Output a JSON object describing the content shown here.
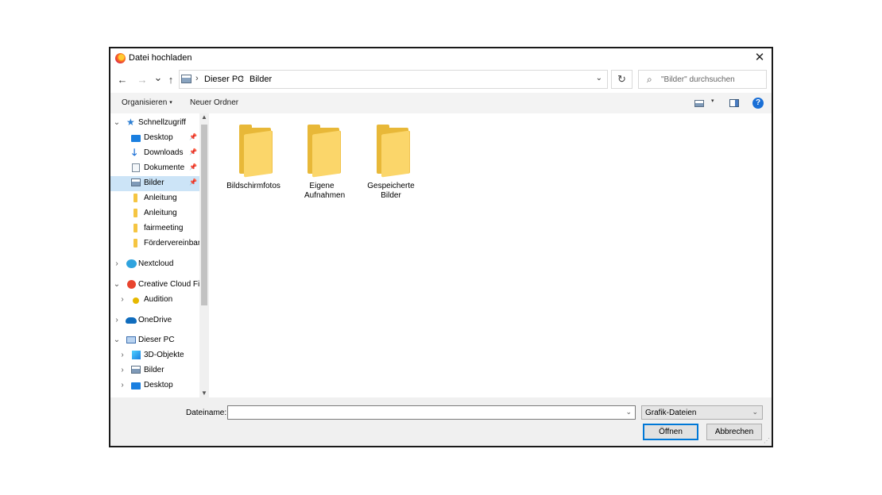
{
  "window": {
    "title": "Datei hochladen",
    "close_glyph": "✕"
  },
  "nav": {
    "back": "←",
    "forward": "→",
    "recent": "⌄",
    "up": "↑"
  },
  "address": {
    "crumbs": [
      "Dieser PC",
      "Bilder"
    ],
    "separator": "›",
    "dropdown": "⌄",
    "refresh": "↻"
  },
  "search": {
    "placeholder": "\"Bilder\" durchsuchen",
    "icon": "⌕"
  },
  "toolbar": {
    "organize": "Organisieren",
    "organize_caret": "▾",
    "new_folder": "Neuer Ordner",
    "view_caret": "▾",
    "help": "?"
  },
  "sidebar": {
    "items": [
      {
        "label": "Schnellzugriff",
        "icon": "star-icon",
        "expanded": true
      },
      {
        "label": "Desktop",
        "icon": "desktop-icon",
        "pinned": true
      },
      {
        "label": "Downloads",
        "icon": "download-icon",
        "pinned": true
      },
      {
        "label": "Dokumente",
        "icon": "document-icon",
        "pinned": true
      },
      {
        "label": "Bilder",
        "icon": "pictures-icon",
        "pinned": true,
        "selected": true
      },
      {
        "label": "Anleitung",
        "icon": "folder-icon"
      },
      {
        "label": "Anleitung",
        "icon": "folder-icon"
      },
      {
        "label": "fairmeeting",
        "icon": "folder-icon"
      },
      {
        "label": "Fördervereinbaru",
        "icon": "folder-icon"
      },
      {
        "label": "Nextcloud",
        "icon": "nextcloud-icon"
      },
      {
        "label": "Creative Cloud File",
        "icon": "creative-cloud-icon",
        "expanded": true
      },
      {
        "label": "Audition",
        "icon": "audition-icon"
      },
      {
        "label": "OneDrive",
        "icon": "onedrive-icon"
      },
      {
        "label": "Dieser PC",
        "icon": "computer-icon",
        "expanded": true
      },
      {
        "label": "3D-Objekte",
        "icon": "3d-objects-icon"
      },
      {
        "label": "Bilder",
        "icon": "pictures-icon"
      },
      {
        "label": "Desktop",
        "icon": "desktop-icon"
      }
    ],
    "chevron_open": "⌄",
    "chevron_closed": "›",
    "pin_glyph": "📌",
    "scroll_up": "▲",
    "scroll_down": "▼"
  },
  "folders": [
    {
      "name": "Bildschirmfotos"
    },
    {
      "name": "Eigene Aufnahmen"
    },
    {
      "name": "Gespeicherte Bilder"
    }
  ],
  "footer": {
    "filename_label": "Dateiname:",
    "filename_value": "",
    "filter_value": "Grafik-Dateien",
    "dropdown": "⌄",
    "open": "Öffnen",
    "cancel": "Abbrechen"
  }
}
